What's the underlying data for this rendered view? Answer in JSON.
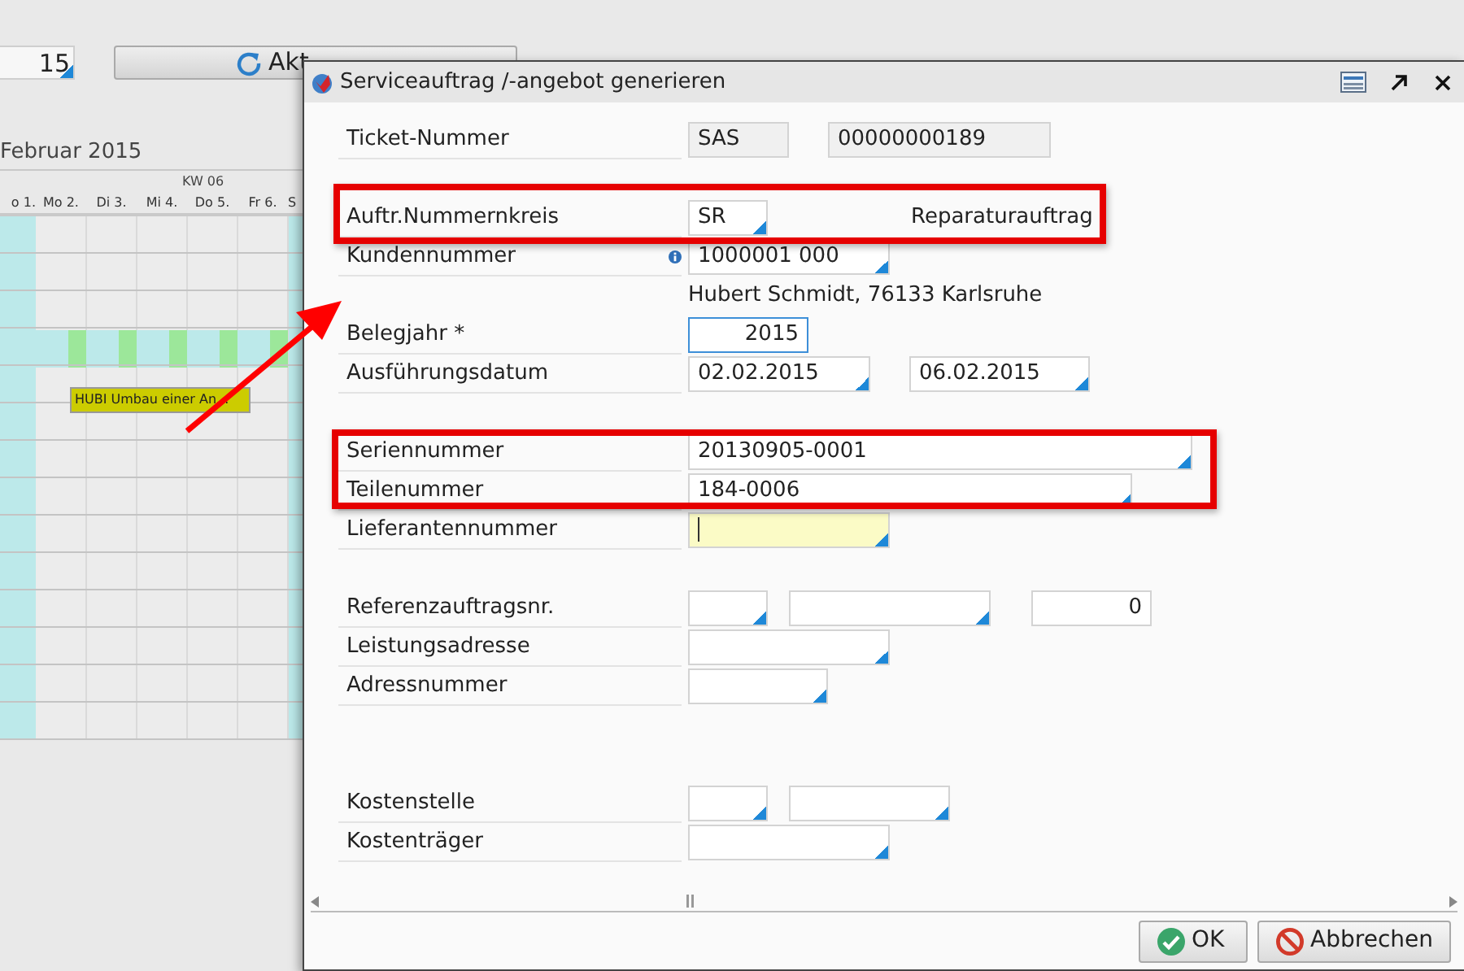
{
  "background": {
    "date_field": {
      "value": "15"
    },
    "refresh_button": {
      "label": "Akt"
    },
    "calendar": {
      "month": "Februar 2015",
      "week": "KW 06",
      "days": [
        "o 1.",
        "Mo 2.",
        "Di 3.",
        "Mi 4.",
        "Do 5.",
        "Fr 6.",
        "S"
      ],
      "event": {
        "label": "HUBI Umbau einer An..."
      }
    }
  },
  "dialog": {
    "title": "Serviceauftrag /-angebot generieren",
    "sections": [
      {
        "rows": [
          {
            "label": "Ticket-Nummer",
            "info": false,
            "fields": [
              {
                "kind": "readonly",
                "value": "SAS",
                "focused": false,
                "editing": false
              },
              {
                "kind": "readonly",
                "value": "00000000189",
                "focused": false,
                "editing": false
              }
            ]
          }
        ]
      },
      {
        "rows": [
          {
            "label": "Auftr.Nummernkreis",
            "info": false,
            "fields": [
              {
                "kind": "lookup",
                "value": "SR",
                "focused": false,
                "editing": false
              }
            ],
            "note": "Reparaturauftrag"
          },
          {
            "label": "Kundennummer",
            "info": true,
            "fields": [
              {
                "kind": "lookup",
                "value": "1000001 000",
                "focused": false,
                "editing": false
              }
            ]
          },
          {
            "note": "Hubert Schmidt, 76133 Karlsruhe"
          },
          {
            "label": "Belegjahr *",
            "info": false,
            "fields": [
              {
                "kind": "number",
                "value": "2015",
                "focused": true,
                "editing": false
              }
            ]
          },
          {
            "label": "Ausführungsdatum",
            "info": false,
            "fields": [
              {
                "kind": "lookup",
                "value": "02.02.2015",
                "focused": false,
                "editing": false
              },
              {
                "kind": "lookup",
                "value": "06.02.2015",
                "focused": false,
                "editing": false
              }
            ]
          }
        ]
      },
      {
        "rows": [
          {
            "label": "Seriennummer",
            "info": false,
            "fields": [
              {
                "kind": "lookup",
                "value": "20130905-0001",
                "focused": false,
                "editing": false
              }
            ]
          },
          {
            "label": "Teilenummer",
            "info": false,
            "fields": [
              {
                "kind": "lookup",
                "value": "184-0006",
                "focused": false,
                "editing": false
              }
            ]
          },
          {
            "label": "Lieferantennummer",
            "info": false,
            "fields": [
              {
                "kind": "lookup",
                "focused": false,
                "editing": true
              }
            ]
          }
        ]
      },
      {
        "rows": [
          {
            "label": "Referenzauftragsnr.",
            "info": false,
            "fields": [
              {
                "kind": "lookup",
                "focused": false,
                "editing": false
              },
              {
                "kind": "lookup",
                "focused": false,
                "editing": false
              },
              {
                "kind": "number",
                "value": "0",
                "focused": false,
                "editing": false
              }
            ]
          },
          {
            "label": "Leistungsadresse",
            "info": false,
            "fields": [
              {
                "kind": "lookup",
                "focused": false,
                "editing": false
              }
            ]
          },
          {
            "label": "Adressnummer",
            "info": false,
            "fields": [
              {
                "kind": "lookup",
                "focused": false,
                "editing": false
              }
            ]
          }
        ]
      },
      {
        "rows": [
          {
            "label": "Kostenstelle",
            "info": false,
            "fields": [
              {
                "kind": "lookup",
                "focused": false,
                "editing": false
              },
              {
                "kind": "lookup",
                "focused": false,
                "editing": false
              }
            ]
          },
          {
            "label": "Kostenträger",
            "info": false,
            "fields": [
              {
                "kind": "lookup",
                "focused": false,
                "editing": false
              }
            ]
          }
        ]
      }
    ],
    "buttons": [
      {
        "kind": "ok",
        "label": "OK"
      },
      {
        "kind": "cancel",
        "label": "Abbrechen"
      }
    ]
  },
  "annotations": [
    {
      "kind": "frame"
    },
    {
      "kind": "frame"
    },
    {
      "kind": "arrow"
    }
  ]
}
